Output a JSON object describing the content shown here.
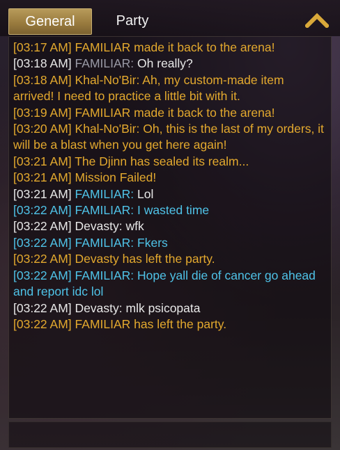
{
  "tabs": [
    {
      "label": "General",
      "active": true
    },
    {
      "label": "Party",
      "active": false
    }
  ],
  "collapse_icon": "chevron-up-icon",
  "colors": {
    "system": "#e3a92e",
    "normal": "#e8e8e8",
    "party": "#4fc3e8",
    "speaker_dim": "#9a9aa6",
    "tab_active": "#9a7c3f"
  },
  "messages": [
    {
      "type": "system",
      "ts": "[03:17 AM]",
      "speaker": "",
      "text": "FAMILIAR made it back to the arena!"
    },
    {
      "type": "normal",
      "ts": "[03:18 AM]",
      "speaker": "FAMILIAR:",
      "text": "Oh really?"
    },
    {
      "type": "system",
      "ts": "[03:18 AM]",
      "speaker": "Khal-No'Bir:",
      "text": "Ah, my custom-made item arrived! I need to practice a little bit with it."
    },
    {
      "type": "system",
      "ts": "[03:19 AM]",
      "speaker": "",
      "text": "FAMILIAR made it back to the arena!"
    },
    {
      "type": "system",
      "ts": "[03:20 AM]",
      "speaker": "Khal-No'Bir:",
      "text": "Oh, this is the last of my orders, it will be a blast when you get here again!"
    },
    {
      "type": "system",
      "ts": "[03:21 AM]",
      "speaker": "",
      "text": "The Djinn has sealed its realm..."
    },
    {
      "type": "system",
      "ts": "[03:21 AM]",
      "speaker": "",
      "text": "Mission Failed!"
    },
    {
      "type": "normal",
      "ts": "[03:21 AM]",
      "speaker": "FAMILIAR:",
      "text": "Lol"
    },
    {
      "type": "party",
      "ts": "[03:22 AM]",
      "speaker": "FAMILIAR:",
      "text": "I wasted time"
    },
    {
      "type": "normal",
      "ts": "[03:22 AM]",
      "speaker": "Devasty:",
      "text": "wfk"
    },
    {
      "type": "party",
      "ts": "[03:22 AM]",
      "speaker": "FAMILIAR:",
      "text": "Fkers"
    },
    {
      "type": "system",
      "ts": "[03:22 AM]",
      "speaker": "",
      "text": "Devasty has left the party."
    },
    {
      "type": "party",
      "ts": "[03:22 AM]",
      "speaker": "FAMILIAR:",
      "text": "Hope yall die of cancer go ahead and report idc lol"
    },
    {
      "type": "normal",
      "ts": "[03:22 AM]",
      "speaker": "Devasty:",
      "text": "mlk psicopata"
    },
    {
      "type": "system",
      "ts": "[03:22 AM]",
      "speaker": "",
      "text": "FAMILIAR has left the party."
    }
  ]
}
